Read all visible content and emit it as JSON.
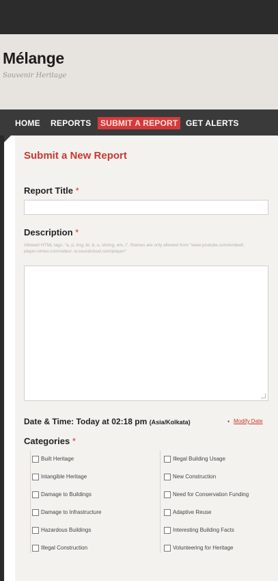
{
  "site": {
    "name": "Mélange",
    "tagline": "Souvenir Heritage"
  },
  "nav": {
    "items": [
      {
        "label": "HOME",
        "active": false
      },
      {
        "label": "REPORTS",
        "active": false
      },
      {
        "label": "SUBMIT A REPORT",
        "active": true
      },
      {
        "label": "GET ALERTS",
        "active": false
      }
    ]
  },
  "form": {
    "title": "Submit a New Report",
    "report_title_label": "Report Title",
    "required_mark": "*",
    "report_title_value": "",
    "description_label": "Description",
    "description_help": "Allowed HTML tags: \"a, p, img, br, b, u, strong, em, i\". Iframes are only allowed from \"www.youtube.com/embed/, player.vimeo.com/video/, w.soundcloud.com/player/\"",
    "description_value": "",
    "datetime_label": "Date & Time: Today at 02:18 pm",
    "timezone": "(Asia/Kolkata)",
    "modify_date_link": "Modify Date",
    "categories_label": "Categories",
    "categories_left": [
      "Built Heritage",
      "Intangible Heritage",
      "Damage to Buildings",
      "Damage to Infrastructure",
      "Hazardous Buildings",
      "Illegal Construction"
    ],
    "categories_right": [
      "Illegal Building Usage",
      "New Construction",
      "Need for Conservation Funding",
      "Adaptive Reuse",
      "Interesting Building Facts",
      "Volunteering for Heritage"
    ]
  },
  "colors": {
    "accent": "#c8372d",
    "nav_bg": "#3a3a3a",
    "header_bg": "#e7e3df",
    "content_bg": "#f4f2ef"
  }
}
